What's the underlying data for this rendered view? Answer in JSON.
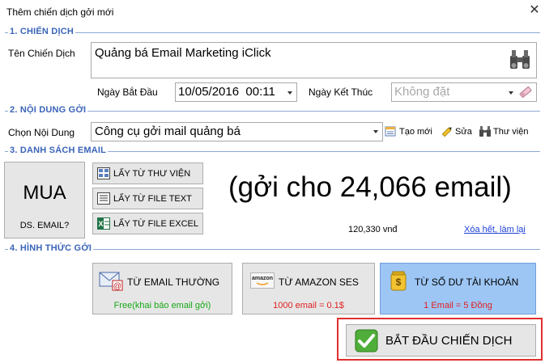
{
  "window": {
    "title": "Thêm chiến dịch gởi mới"
  },
  "section1": {
    "label": "1. CHIẾN DỊCH",
    "name_label": "Tên Chiến Dịch",
    "name_value": "Quảng bá Email Marketing iClick",
    "start_label": "Ngày Bắt Đầu",
    "start_value": "10/05/2016  00:11",
    "end_label": "Ngày Kết Thúc",
    "end_placeholder": "Không đặt"
  },
  "section2": {
    "label": "2. NỘI DUNG GỞI",
    "content_label": "Chọn Nội Dung",
    "content_value": "Công cụ gởi mail quảng bá",
    "new_label": "Tạo mới",
    "edit_label": "Sửa",
    "library_label": "Thư viện"
  },
  "section3": {
    "label": "3. DANH SÁCH EMAIL",
    "buy_title": "MUA",
    "buy_sub": "DS. EMAIL?",
    "from_library": "LẤY TỪ THƯ VIỆN",
    "from_text": "LẤY TỪ FILE TEXT",
    "from_excel": "LẤY TỪ FILE EXCEL",
    "summary": "(gởi cho 24,066 email)",
    "price": "120,330 vnđ",
    "clear_link": "Xóa hết, làm lại"
  },
  "section4": {
    "label": "4. HÌNH THỨC GỞI",
    "options": [
      {
        "label": "TỪ EMAIL THƯỜNG",
        "note": "Free(khai báo email gởi)",
        "note_color": "#17a817"
      },
      {
        "label": "TỪ AMAZON SES",
        "note": "1000 email = 0.1$",
        "note_color": "#e02020"
      },
      {
        "label": "TỪ SỐ DƯ TÀI KHOẢN",
        "note": "1 Email = 5 Đồng",
        "note_color": "#e02020"
      }
    ],
    "amazon_logo": "amazon",
    "selected_index": 2
  },
  "start_button": {
    "label": "BẮT ĐẦU CHIẾN DỊCH"
  },
  "colors": {
    "accent": "#3a64b8",
    "selected_bg": "#9dc6f5",
    "highlight_border": "#e03030"
  }
}
